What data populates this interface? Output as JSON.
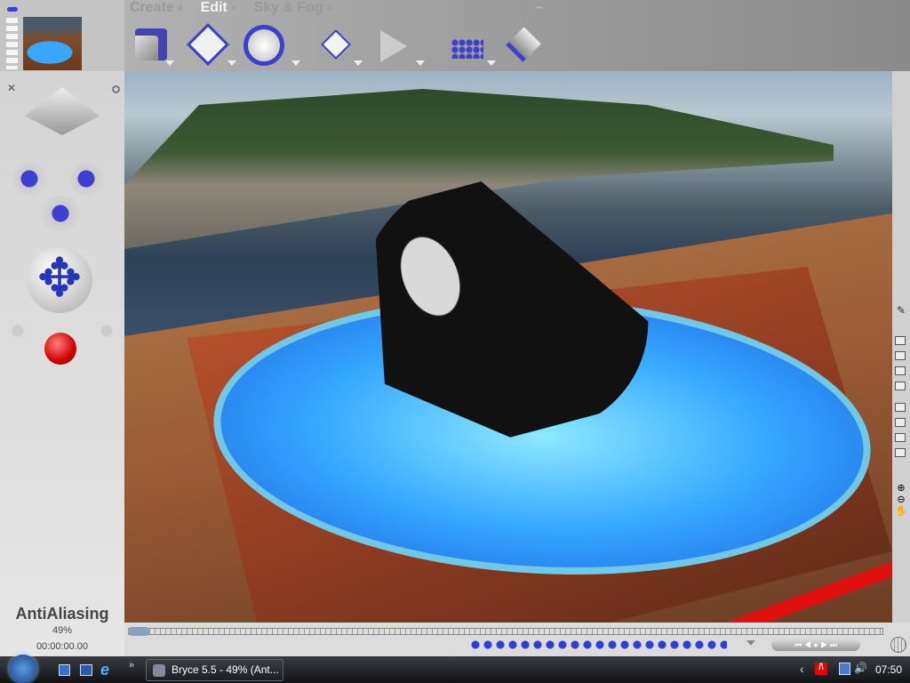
{
  "palettes": {
    "create": "Create",
    "edit": "Edit",
    "sky_fog": "Sky & Fog",
    "arrow": "›"
  },
  "status": {
    "title": "AntiAliasing",
    "percent": "49%",
    "time": "00:00:00.00"
  },
  "taskbar": {
    "task_label": "Bryce 5.5 - 49% (Ant...",
    "clock": "07:50",
    "chevron": "»",
    "tray_chevron": "‹"
  },
  "colors": {
    "accent": "#3d3fd0",
    "toolbar": "#a8a8a8",
    "panel": "#dcdcdc"
  }
}
